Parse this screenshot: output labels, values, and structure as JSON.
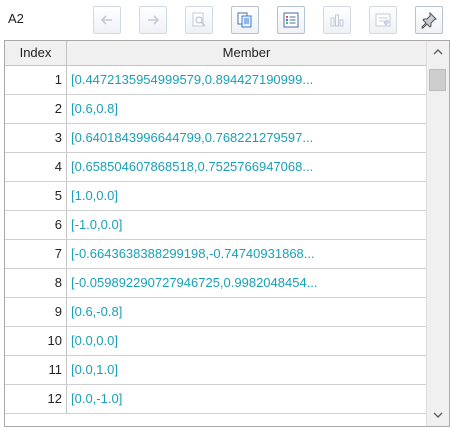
{
  "cell_ref": "A2",
  "toolbar": {
    "buttons": [
      {
        "name": "back-button",
        "icon": "arrow-left-icon",
        "enabled": false
      },
      {
        "name": "forward-button",
        "icon": "arrow-right-icon",
        "enabled": false
      },
      {
        "name": "preview-button",
        "icon": "magnifier-page-icon",
        "enabled": false
      },
      {
        "name": "copy-button",
        "icon": "copy-icon",
        "enabled": true
      },
      {
        "name": "list-button",
        "icon": "list-icon",
        "enabled": true
      },
      {
        "name": "chart-button",
        "icon": "bar-chart-icon",
        "enabled": false
      },
      {
        "name": "properties-button",
        "icon": "properties-icon",
        "enabled": false
      },
      {
        "name": "pin-button",
        "icon": "pin-icon",
        "enabled": true
      }
    ]
  },
  "table": {
    "columns": [
      "Index",
      "Member"
    ],
    "rows": [
      {
        "index": "1",
        "member": "[0.4472135954999579,0.894427190999..."
      },
      {
        "index": "2",
        "member": "[0.6,0.8]"
      },
      {
        "index": "3",
        "member": "[0.6401843996644799,0.768221279597..."
      },
      {
        "index": "4",
        "member": "[0.658504607868518,0.7525766947068..."
      },
      {
        "index": "5",
        "member": "[1.0,0.0]"
      },
      {
        "index": "6",
        "member": "[-1.0,0.0]"
      },
      {
        "index": "7",
        "member": "[-0.6643638388299198,-0.74740931868..."
      },
      {
        "index": "8",
        "member": "[-0.059892290727946725,0.9982048454..."
      },
      {
        "index": "9",
        "member": "[0.6,-0.8]"
      },
      {
        "index": "10",
        "member": "[0.0,0.0]"
      },
      {
        "index": "11",
        "member": "[0.0,1.0]"
      },
      {
        "index": "12",
        "member": "[0.0,-1.0]"
      }
    ]
  },
  "colors": {
    "member_text": "#19a0b6",
    "accent_icon": "#3a7bd5"
  }
}
